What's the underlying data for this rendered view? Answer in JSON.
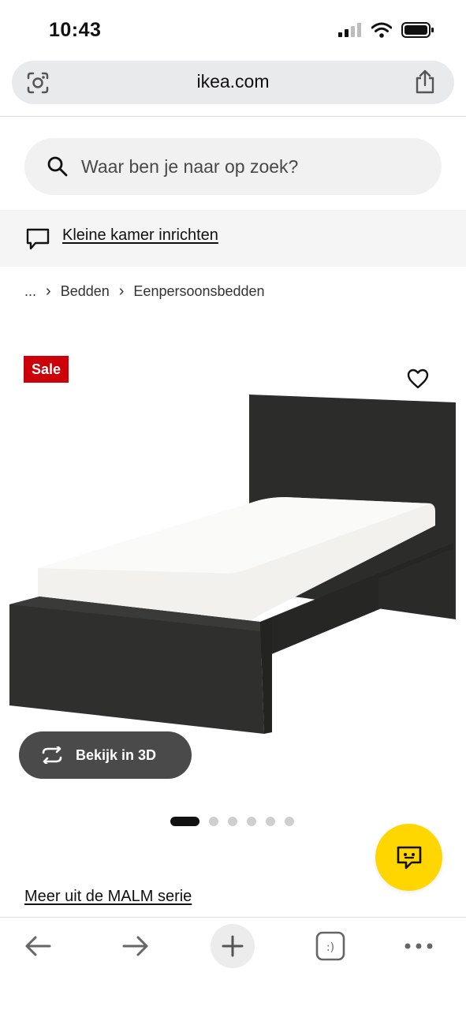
{
  "status_bar": {
    "time": "10:43"
  },
  "browser": {
    "url": "ikea.com",
    "lens_icon": "camera-lens-icon",
    "share_icon": "share-icon"
  },
  "search": {
    "placeholder": "Waar ben je naar op zoek?",
    "icon": "search-icon"
  },
  "promo": {
    "label": "Kleine kamer inrichten",
    "icon": "chat-bubble-icon"
  },
  "breadcrumb": {
    "ellipsis": "...",
    "items": [
      "Bedden",
      "Eenpersoonsbedden"
    ]
  },
  "product": {
    "badge": "Sale",
    "badge_color": "#cc0008",
    "wishlist_icon": "heart-icon",
    "view_3d_label": "Bekijk in 3D",
    "image_count": 6,
    "active_image": 1
  },
  "series_link": "Meer uit de MALM serie",
  "chat": {
    "icon": "chat-assistant-icon",
    "color": "#ffd600"
  },
  "toolbar": {
    "back_icon": "back-arrow-icon",
    "forward_icon": "forward-arrow-icon",
    "new_tab_icon": "plus-icon",
    "tabs_label": ":)",
    "menu_icon": "more-dots-icon"
  }
}
